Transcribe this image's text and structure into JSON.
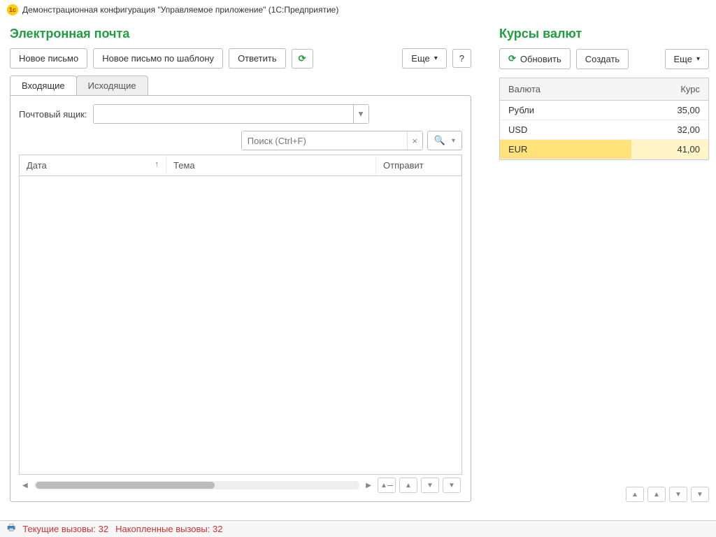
{
  "title": "Демонстрационная конфигурация \"Управляемое приложение\"  (1С:Предприятие)",
  "left": {
    "title": "Электронная почта",
    "toolbar": {
      "new_mail": "Новое письмо",
      "new_mail_template": "Новое письмо по шаблону",
      "reply": "Ответить",
      "more": "Еще",
      "help": "?"
    },
    "tabs": {
      "inbox": "Входящие",
      "outbox": "Исходящие"
    },
    "mailbox_label": "Почтовый ящик:",
    "search_placeholder": "Поиск (Ctrl+F)",
    "columns": {
      "date": "Дата",
      "subject": "Тема",
      "sender": "Отправит"
    }
  },
  "right": {
    "title": "Курсы валют",
    "toolbar": {
      "refresh": "Обновить",
      "create": "Создать",
      "more": "Еще"
    },
    "columns": {
      "currency": "Валюта",
      "rate": "Курс"
    },
    "rows": [
      {
        "name": "Рубли",
        "rate": "35,00",
        "selected": false
      },
      {
        "name": "USD",
        "rate": "32,00",
        "selected": false
      },
      {
        "name": "EUR",
        "rate": "41,00",
        "selected": true
      }
    ]
  },
  "status": {
    "current_label": "Текущие вызовы:",
    "current_value": "32",
    "accumulated_label": "Накопленные вызовы:",
    "accumulated_value": "32"
  }
}
